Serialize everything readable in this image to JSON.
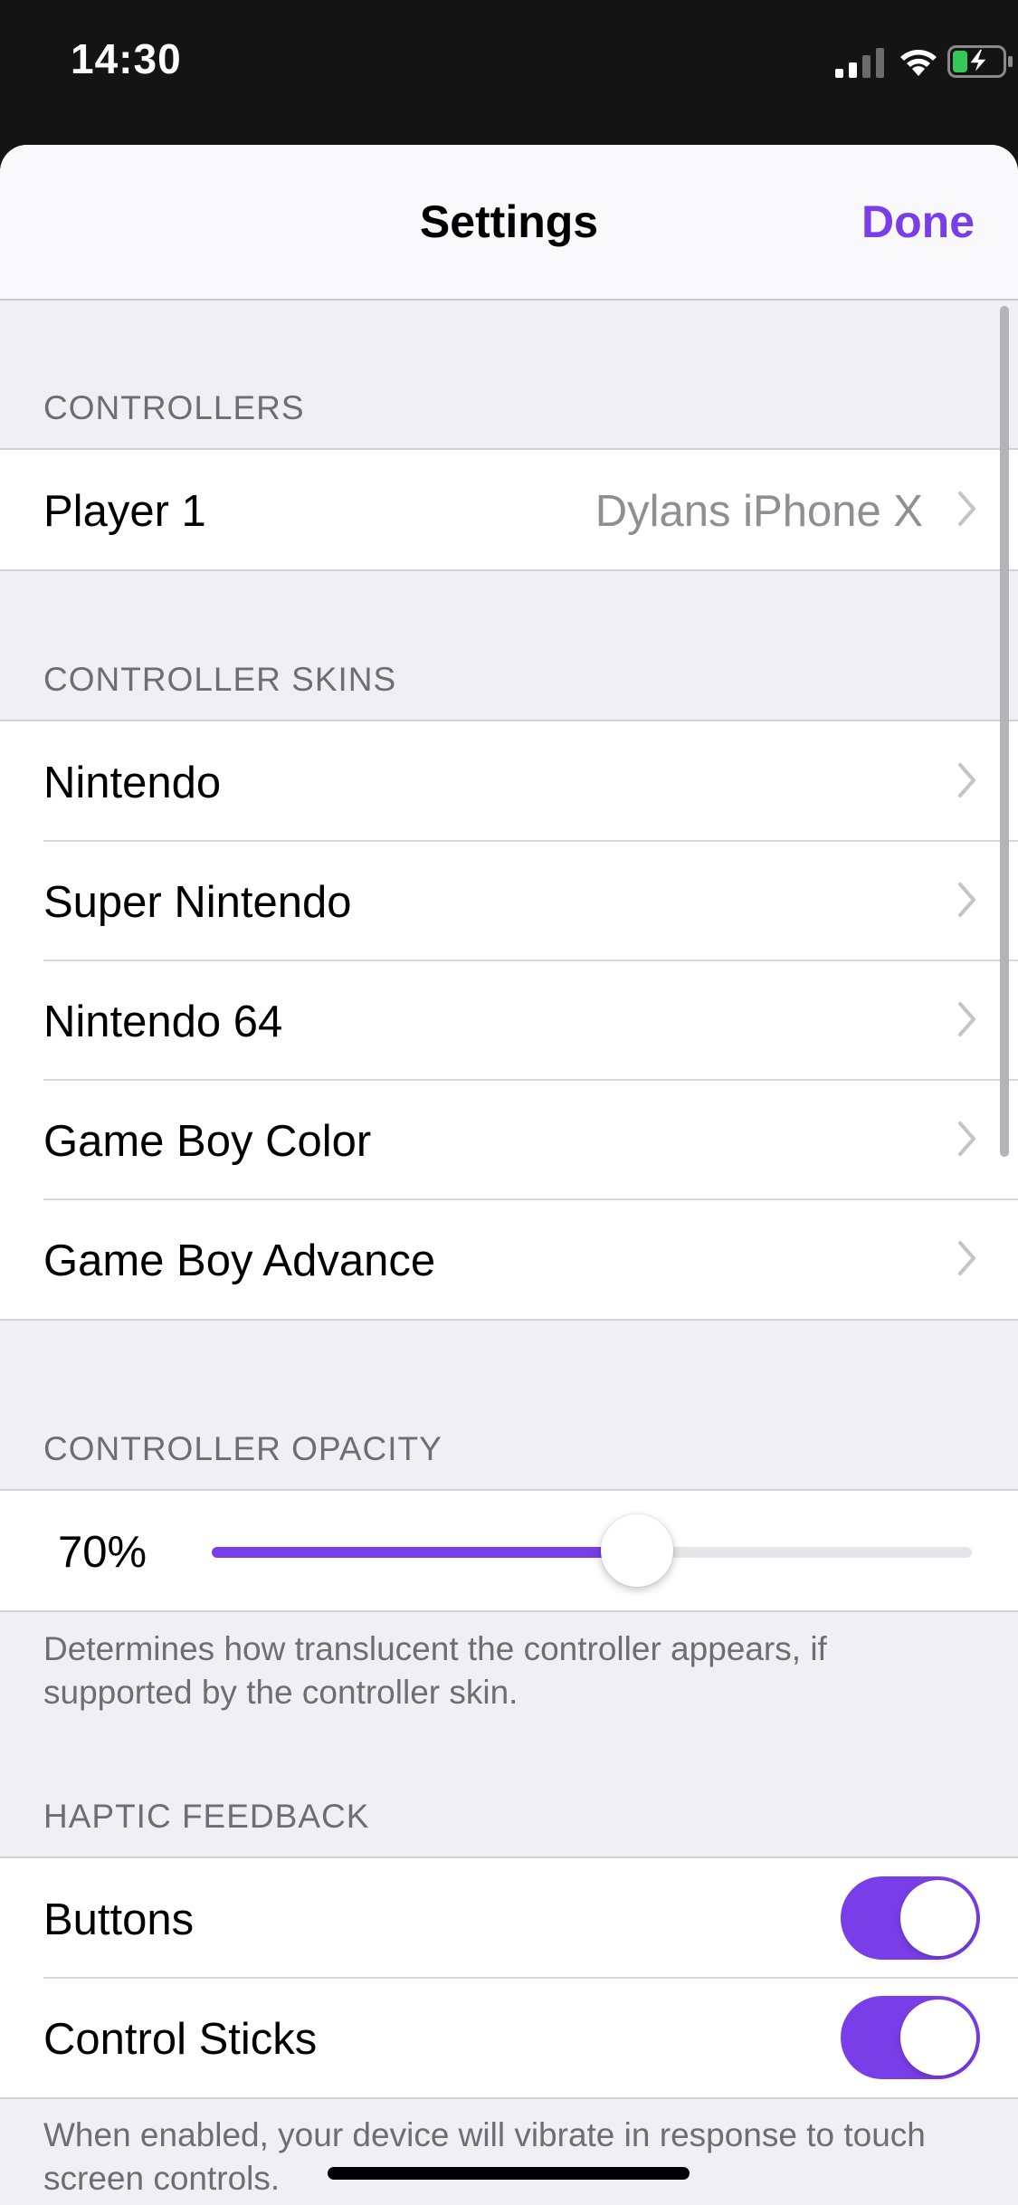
{
  "status_bar": {
    "time": "14:30"
  },
  "nav": {
    "title": "Settings",
    "done_label": "Done"
  },
  "colors": {
    "accent": "#7a3ee8",
    "background": "#efeff4",
    "secondary_text": "#8e8e93"
  },
  "controllers": {
    "header": "CONTROLLERS",
    "rows": [
      {
        "label": "Player 1",
        "detail": "Dylans iPhone X",
        "icon": "chevron-right-icon"
      }
    ]
  },
  "controller_skins": {
    "header": "CONTROLLER SKINS",
    "rows": [
      {
        "label": "Nintendo",
        "icon": "chevron-right-icon"
      },
      {
        "label": "Super Nintendo",
        "icon": "chevron-right-icon"
      },
      {
        "label": "Nintendo 64",
        "icon": "chevron-right-icon"
      },
      {
        "label": "Game Boy Color",
        "icon": "chevron-right-icon"
      },
      {
        "label": "Game Boy Advance",
        "icon": "chevron-right-icon"
      }
    ]
  },
  "controller_opacity": {
    "header": "CONTROLLER OPACITY",
    "value_label": "70%",
    "value": 0.7,
    "footer": "Determines how translucent the controller appears, if supported by the controller skin."
  },
  "haptic_feedback": {
    "header": "HAPTIC FEEDBACK",
    "rows": [
      {
        "label": "Buttons",
        "enabled": true
      },
      {
        "label": "Control Sticks",
        "enabled": true
      }
    ],
    "footer": "When enabled, your device will vibrate in response to touch screen controls."
  }
}
